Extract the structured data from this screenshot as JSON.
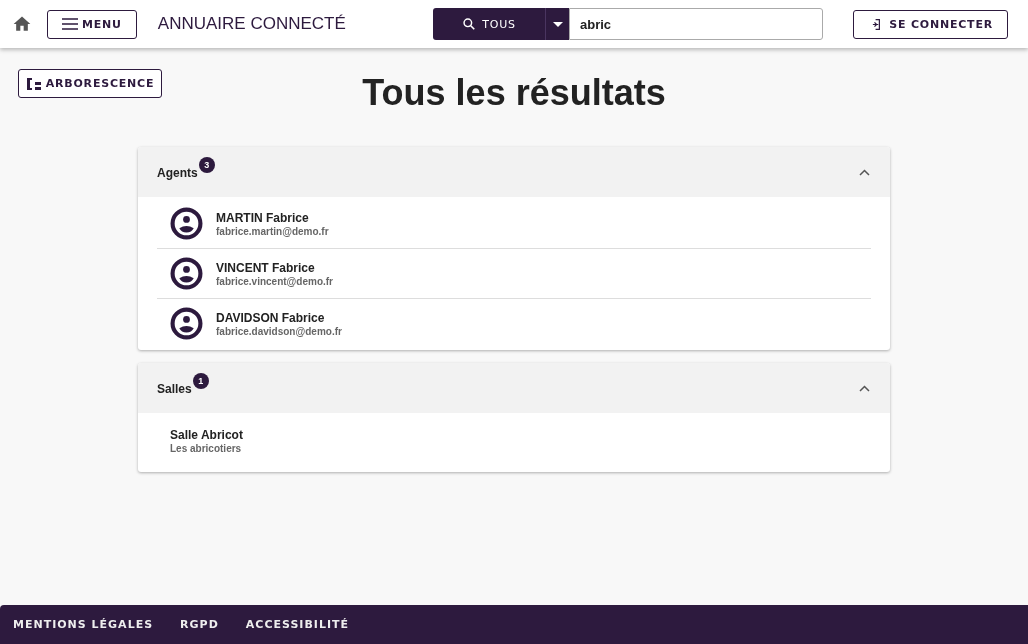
{
  "header": {
    "menu_label": "MENU",
    "app_title": "ANNUAIRE CONNECTÉ",
    "search_scope": "TOUS",
    "search_value": "abric",
    "login_label": "SE CONNECTER"
  },
  "tree_button": {
    "label": "ARBORESCENCE"
  },
  "page_title": "Tous les résultats",
  "sections": [
    {
      "title": "Agents",
      "count": "3",
      "expanded": true,
      "items": [
        {
          "kind": "person",
          "name": "MARTIN Fabrice",
          "detail": "fabrice.martin@demo.fr"
        },
        {
          "kind": "person",
          "name": "VINCENT Fabrice",
          "detail": "fabrice.vincent@demo.fr"
        },
        {
          "kind": "person",
          "name": "DAVIDSON Fabrice",
          "detail": "fabrice.davidson@demo.fr"
        }
      ]
    },
    {
      "title": "Salles",
      "count": "1",
      "expanded": true,
      "items": [
        {
          "kind": "room",
          "name": "Salle Abricot",
          "detail": "Les abricotiers"
        }
      ]
    }
  ],
  "footer": {
    "links": [
      "MENTIONS LÉGALES",
      "RGPD",
      "ACCESSIBILITÉ"
    ]
  }
}
